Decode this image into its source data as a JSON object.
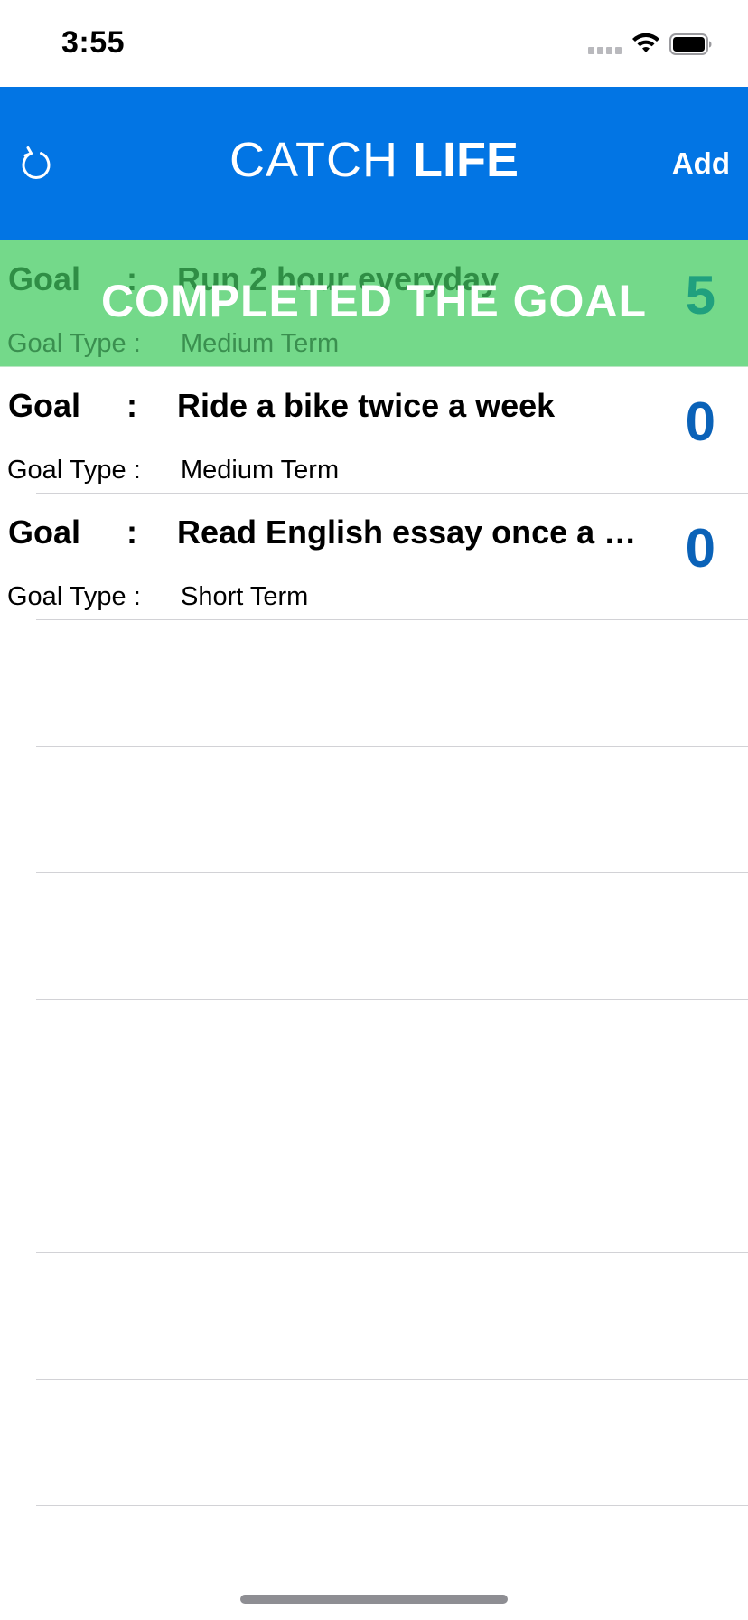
{
  "status_bar": {
    "time": "3:55",
    "signal_icon": "cellular-signal-icon",
    "wifi_icon": "wifi-icon",
    "battery_icon": "battery-icon"
  },
  "nav": {
    "title_light": "CATCH ",
    "title_bold": "LIFE",
    "refresh_icon": "refresh-icon",
    "add_label": "Add",
    "color": "#0275e4"
  },
  "goals": [
    {
      "goal_label": "Goal",
      "colon": ":",
      "goal": "Run 2 hour everyday",
      "type_label": "Goal Type :",
      "type": "Medium Term",
      "count": "5",
      "completed": true,
      "completed_label": "COMPLETED THE GOAL"
    },
    {
      "goal_label": "Goal",
      "colon": ":",
      "goal": "Ride a bike twice a week",
      "type_label": "Goal Type :",
      "type": "Medium Term",
      "count": "0",
      "completed": false
    },
    {
      "goal_label": "Goal",
      "colon": ":",
      "goal": "Read English essay once a week",
      "type_label": "Goal Type :",
      "type": "Short Term",
      "count": "0",
      "completed": false
    }
  ],
  "colors": {
    "completed_bg": "#74d98a",
    "count": "#0a62b8"
  }
}
